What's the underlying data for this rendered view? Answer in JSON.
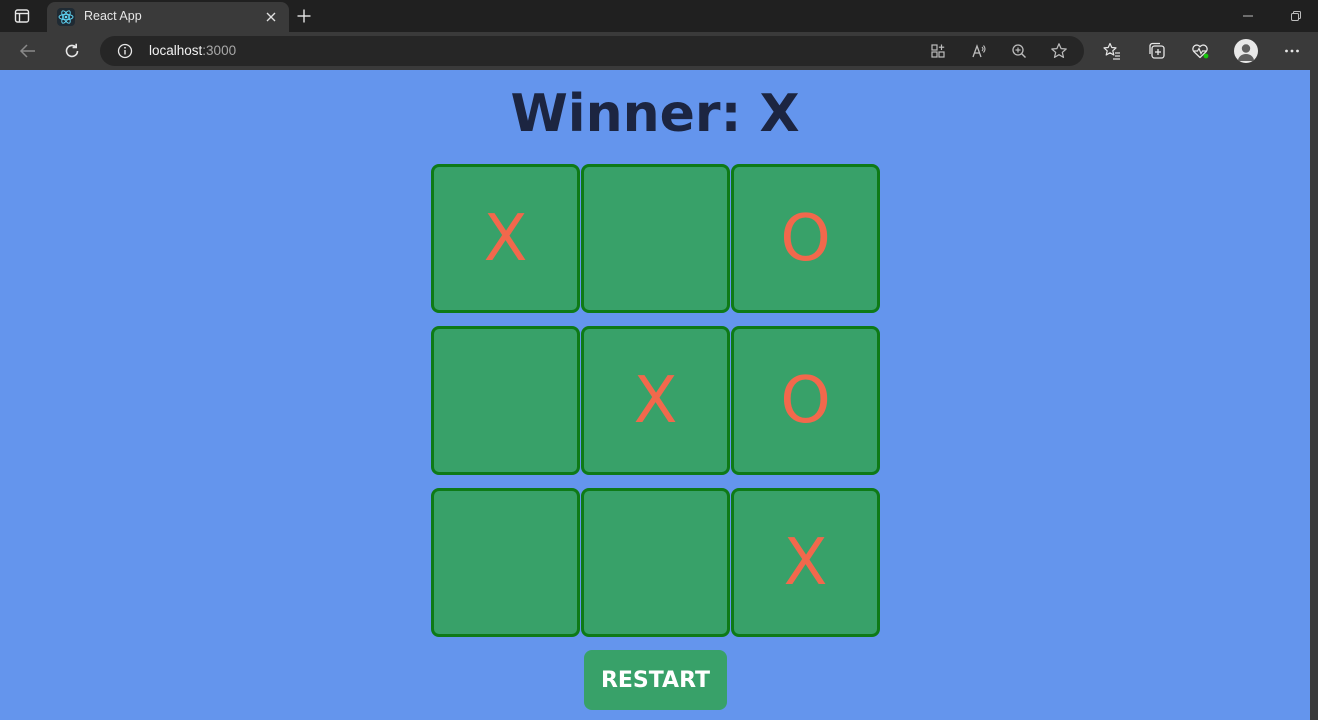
{
  "browser": {
    "tab_title": "React App",
    "url_host": "localhost",
    "url_port": ":3000"
  },
  "icons": {
    "tab_actions": "tab-actions-icon",
    "favicon": "react-logo-icon",
    "tab_close": "close-icon",
    "new_tab": "plus-icon",
    "back": "back-arrow-icon",
    "refresh": "refresh-icon",
    "site_info": "info-icon",
    "app_available": "apps-icon",
    "read_aloud": "read-aloud-icon",
    "zoom": "zoom-icon",
    "favorite": "star-icon",
    "favorites": "favorites-icon",
    "collections": "collections-icon",
    "performance": "heartbeat-icon",
    "profile": "avatar",
    "menu": "more-icon"
  },
  "game": {
    "status": "Winner: X",
    "cells": [
      "X",
      "",
      "O",
      "",
      "X",
      "O",
      "",
      "",
      "X"
    ],
    "restart_label": "RESTART"
  },
  "colors": {
    "page_background": "#6495ed",
    "cell_fill": "#38a169",
    "cell_border": "#0e7a17",
    "mark_color": "#f2684c",
    "heading_color": "#1c2541"
  }
}
